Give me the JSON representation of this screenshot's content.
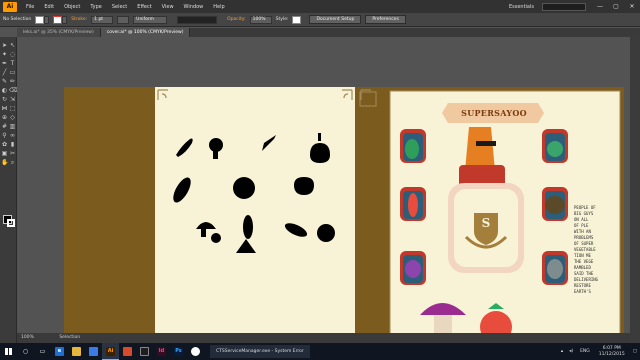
{
  "app": {
    "logo": "Ai",
    "menu": [
      "File",
      "Edit",
      "Object",
      "Type",
      "Select",
      "Effect",
      "View",
      "Window",
      "Help"
    ],
    "workspace": "Essentials",
    "window_buttons": [
      "—",
      "▢",
      "✕"
    ]
  },
  "control_bar": {
    "selection": "No Selection",
    "stroke_label": "Stroke:",
    "stroke_weight": "1 pt",
    "profile": "Uniform",
    "opacity_label": "Opacity:",
    "opacity": "100%",
    "style_label": "Style:",
    "document_setup": "Document Setup",
    "preferences": "Preferences"
  },
  "tabs": [
    {
      "label": "leks.ai* @ 35% (CMYK/Preview)",
      "active": false
    },
    {
      "label": "cover.ai* @ 100% (CMYK/Preview)",
      "active": true
    }
  ],
  "artwork": {
    "title": "SUPERSAYOO",
    "seal_letter": "S",
    "body_text": [
      "PEOPLE OF",
      "BIG GUYS",
      "ON ALL ",
      "OF PLE",
      "WITH AN",
      "PROBLEMS",
      "OF SUPER",
      "VEGETABLE",
      "TION ME",
      "THE VEGE",
      "RAMBLED",
      "SAID THE",
      "DELIVERING",
      "RESTORE",
      "EARTH'S"
    ]
  },
  "status_bar": {
    "zoom": "100%",
    "mode": "Selection"
  },
  "taskbar": {
    "error_task": "CTSServiceManager.exe - System Error",
    "language": "ENG",
    "time": "6:07 PM",
    "date": "11/12/2015"
  },
  "colors": {
    "brown": "#7b5c1e",
    "cream": "#f8f3d6",
    "gold": "#a08a5a",
    "accent_orange": "#ff9a00"
  }
}
